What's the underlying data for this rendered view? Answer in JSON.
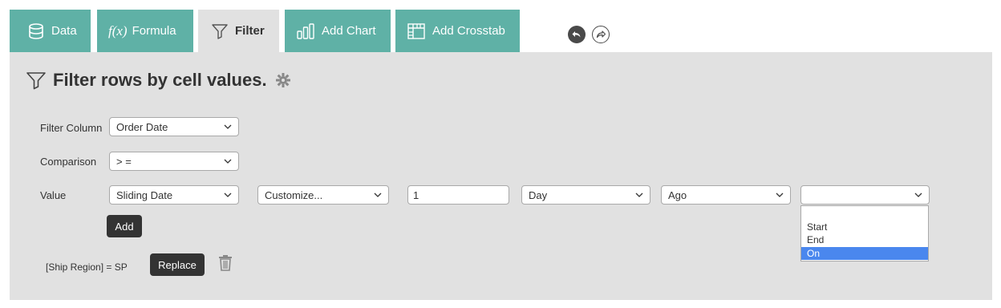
{
  "tabs": [
    {
      "label": "Data",
      "icon": "database-icon"
    },
    {
      "label": "Formula",
      "icon": "formula-icon",
      "prefix": "f(x)"
    },
    {
      "label": "Filter",
      "icon": "filter-icon",
      "active": true
    },
    {
      "label": "Add Chart",
      "icon": "bar-chart-icon"
    },
    {
      "label": "Add Crosstab",
      "icon": "crosstab-icon"
    }
  ],
  "toolbar": {
    "undo_icon": "undo-icon",
    "redo_icon": "redo-icon"
  },
  "panel": {
    "title": "Filter rows by cell values.",
    "labels": {
      "filter_column": "Filter Column",
      "comparison": "Comparison",
      "value": "Value"
    },
    "filter_column_value": "Order Date",
    "comparison_value": "> =",
    "value_type": "Sliding Date",
    "customize_value": "Customize...",
    "amount_value": "1",
    "unit_value": "Day",
    "direction_value": "Ago",
    "position_value": "",
    "position_options": [
      "",
      "Start",
      "End",
      "On"
    ],
    "position_highlighted": "On",
    "add_label": "Add",
    "existing_filter": "[Ship Region] = SP",
    "replace_label": "Replace"
  },
  "colors": {
    "tab_bg": "#5fb1a6",
    "panel_bg": "#e1e1e1",
    "button_bg": "#333333",
    "highlight": "#4a87ee"
  }
}
